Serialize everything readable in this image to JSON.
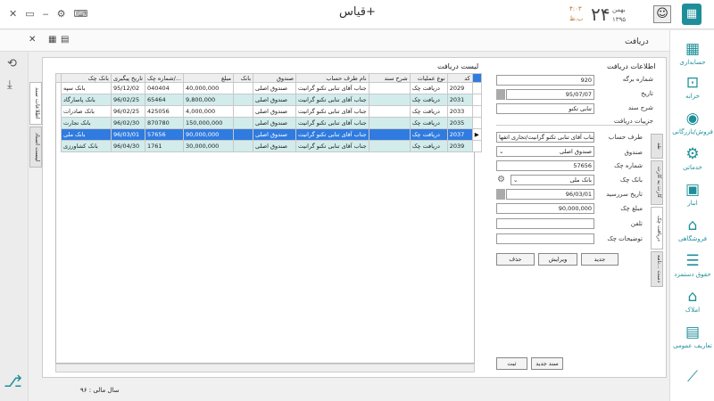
{
  "window": {
    "title": "قیاس+",
    "controls": [
      "✕",
      "▭",
      "‒",
      "⚙",
      "⌨"
    ]
  },
  "date": {
    "day": "۲۴",
    "month": "بهمن",
    "year": "۱۳۹۵",
    "time": "۴:۰۳",
    "ampm": "ب.ظ"
  },
  "page": {
    "title": "دریافت"
  },
  "toolbar": {
    "close": "✕",
    "grid": "▦",
    "calc": "▤"
  },
  "sidebar": [
    {
      "label": "حسابداری",
      "icon": "▦"
    },
    {
      "label": "خزانه",
      "icon": "⊡"
    },
    {
      "label": "فروش/بازرگانی",
      "icon": "◉"
    },
    {
      "label": "خدماتی",
      "icon": "⚙"
    },
    {
      "label": "انبار",
      "icon": "▣"
    },
    {
      "label": "فروشگاهی",
      "icon": "⌂"
    },
    {
      "label": "حقوق دستمزد",
      "icon": "☰"
    },
    {
      "label": "املاک",
      "icon": "⌂"
    },
    {
      "label": "تعاریف عمومی",
      "icon": "▤"
    },
    {
      "label": "",
      "icon": "⟋"
    }
  ],
  "left_tabs": [
    "اطلاعات سند",
    "لیست اسناد"
  ],
  "list": {
    "title": "لیست دریافت",
    "columns": [
      "بانک چک",
      "تاریخ پیگیری",
      "شماره چک/...",
      "مبلغ",
      "بانک",
      "صندوق",
      "نام طرف حساب",
      "شرح سند",
      "نوع عملیات",
      "کد"
    ],
    "rows": [
      [
        "بانک سپه",
        "95/12/02",
        "040404",
        "40,000,000",
        "",
        "صندوق اصلی",
        "جناب آقای تنابی تکنو گرانیت",
        "",
        "دریافت چک",
        "2029"
      ],
      [
        "بانک پاسارگاد",
        "96/02/25",
        "65464",
        "9,800,000",
        "",
        "صندوق اصلی",
        "جناب آقای تنابی تکنو گرانیت",
        "",
        "دریافت چک",
        "2031"
      ],
      [
        "بانک صادرات",
        "96/02/25",
        "425056",
        "4,000,000",
        "",
        "صندوق اصلی",
        "جناب آقای تنابی تکنو گرانیت",
        "",
        "دریافت چک",
        "2033"
      ],
      [
        "بانک تجارت",
        "96/02/30",
        "870780",
        "150,000,000",
        "",
        "صندوق اصلی",
        "جناب آقای تنابی تکنو گرانیت",
        "",
        "دریافت چک",
        "2035"
      ],
      [
        "بانک ملی",
        "96/03/01",
        "57656",
        "90,000,000",
        "",
        "صندوق اصلی",
        "جناب آقای تنابی تکنو گرانیت",
        "",
        "دریافت چک",
        "2037"
      ],
      [
        "بانک کشاورزی",
        "96/04/30",
        "1761",
        "30,000,000",
        "",
        "صندوق اصلی",
        "جناب آقای تنابی تکنو گرانیت",
        "",
        "دریافت چک",
        "2039"
      ]
    ]
  },
  "info": {
    "title": "اطلاعات دریافت",
    "sheet_label": "شماره برگه",
    "sheet_value": "920",
    "date_label": "تاریخ",
    "date_value": "95/07/07",
    "desc_label": "شرح سند",
    "desc_value": "تنابی تکنو"
  },
  "details": {
    "title": "جزییات دریافت",
    "party_label": "طرف حساب",
    "party_value": "جناب آقای تنابی تکنو گرانیت/تجاری اتفها",
    "fund_label": "صندوق",
    "fund_value": "صندوق اصلی",
    "check_label": "شماره چک",
    "check_value": "57656",
    "bank_label": "بانک چک",
    "bank_value": "بانک ملی",
    "due_label": "تاریخ سررسید",
    "due_value": "96/03/01",
    "amount_label": "مبلغ چک",
    "amount_value": "90,000,000",
    "phone_label": "تلفن",
    "phone_value": "",
    "note_label": "توضیحات چک",
    "note_value": ""
  },
  "sub_tabs": [
    "نقد",
    "کارت به کارت",
    "دریافت چک",
    "دست ...نامه"
  ],
  "buttons": {
    "new": "جدید",
    "edit": "ویرایش",
    "delete": "حذف",
    "new_doc": "سند جدید",
    "save": "ثبت"
  },
  "footer": {
    "fiscal": "سال مالی : ۹۶"
  }
}
